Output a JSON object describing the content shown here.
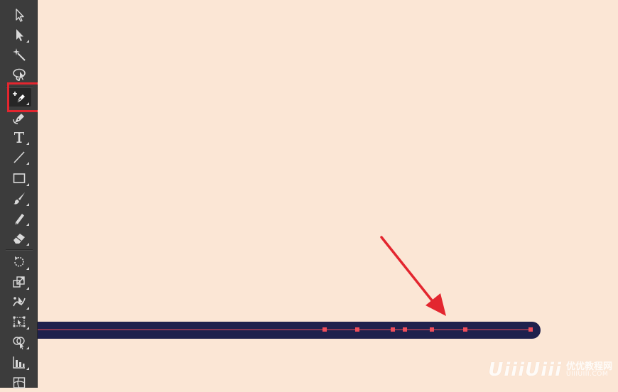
{
  "toolbar": {
    "tools": [
      {
        "name": "selection-tool",
        "icon": "selection-arrow-icon",
        "selected": false
      },
      {
        "name": "direct-selection-tool",
        "icon": "direct-selection-arrow-icon",
        "selected": false
      },
      {
        "name": "magic-wand-tool",
        "icon": "magic-wand-icon",
        "selected": false
      },
      {
        "name": "lasso-tool",
        "icon": "lasso-icon",
        "selected": false
      },
      {
        "name": "add-anchor-point-tool",
        "icon": "pen-plus-icon",
        "selected": true
      },
      {
        "name": "curvature-tool",
        "icon": "pen-curve-icon",
        "selected": false
      },
      {
        "name": "type-tool",
        "icon": "type-icon",
        "label": "T",
        "selected": false
      },
      {
        "name": "line-segment-tool",
        "icon": "line-icon",
        "selected": false
      },
      {
        "name": "rectangle-tool",
        "icon": "rectangle-icon",
        "selected": false
      },
      {
        "name": "paintbrush-tool",
        "icon": "paintbrush-icon",
        "selected": false
      },
      {
        "name": "pencil-tool",
        "icon": "pencil-icon",
        "selected": false
      },
      {
        "name": "eraser-tool",
        "icon": "eraser-icon",
        "selected": false
      },
      {
        "name": "rotate-tool",
        "icon": "rotate-icon",
        "selected": false
      },
      {
        "name": "scale-tool",
        "icon": "scale-icon",
        "selected": false
      },
      {
        "name": "puppet-warp-tool",
        "icon": "puppet-warp-icon",
        "selected": false
      },
      {
        "name": "free-transform-tool",
        "icon": "free-transform-icon",
        "selected": false
      },
      {
        "name": "shape-builder-tool",
        "icon": "shape-builder-icon",
        "selected": false
      },
      {
        "name": "column-graph-tool",
        "icon": "graph-icon",
        "selected": false
      },
      {
        "name": "mesh-tool",
        "icon": "mesh-icon",
        "selected": false
      }
    ],
    "highlight_color": "#e3262f"
  },
  "canvas": {
    "background_color": "#fbe6d5",
    "stroke_color": "#1f214d",
    "path_color": "#ee4e5b",
    "anchor_count": 7,
    "annotation_arrow_color": "#e3262f"
  },
  "watermark": {
    "logo": "UiiiUiii",
    "text_cn": "优优教程网",
    "url": "UIIIUIII.COM"
  }
}
